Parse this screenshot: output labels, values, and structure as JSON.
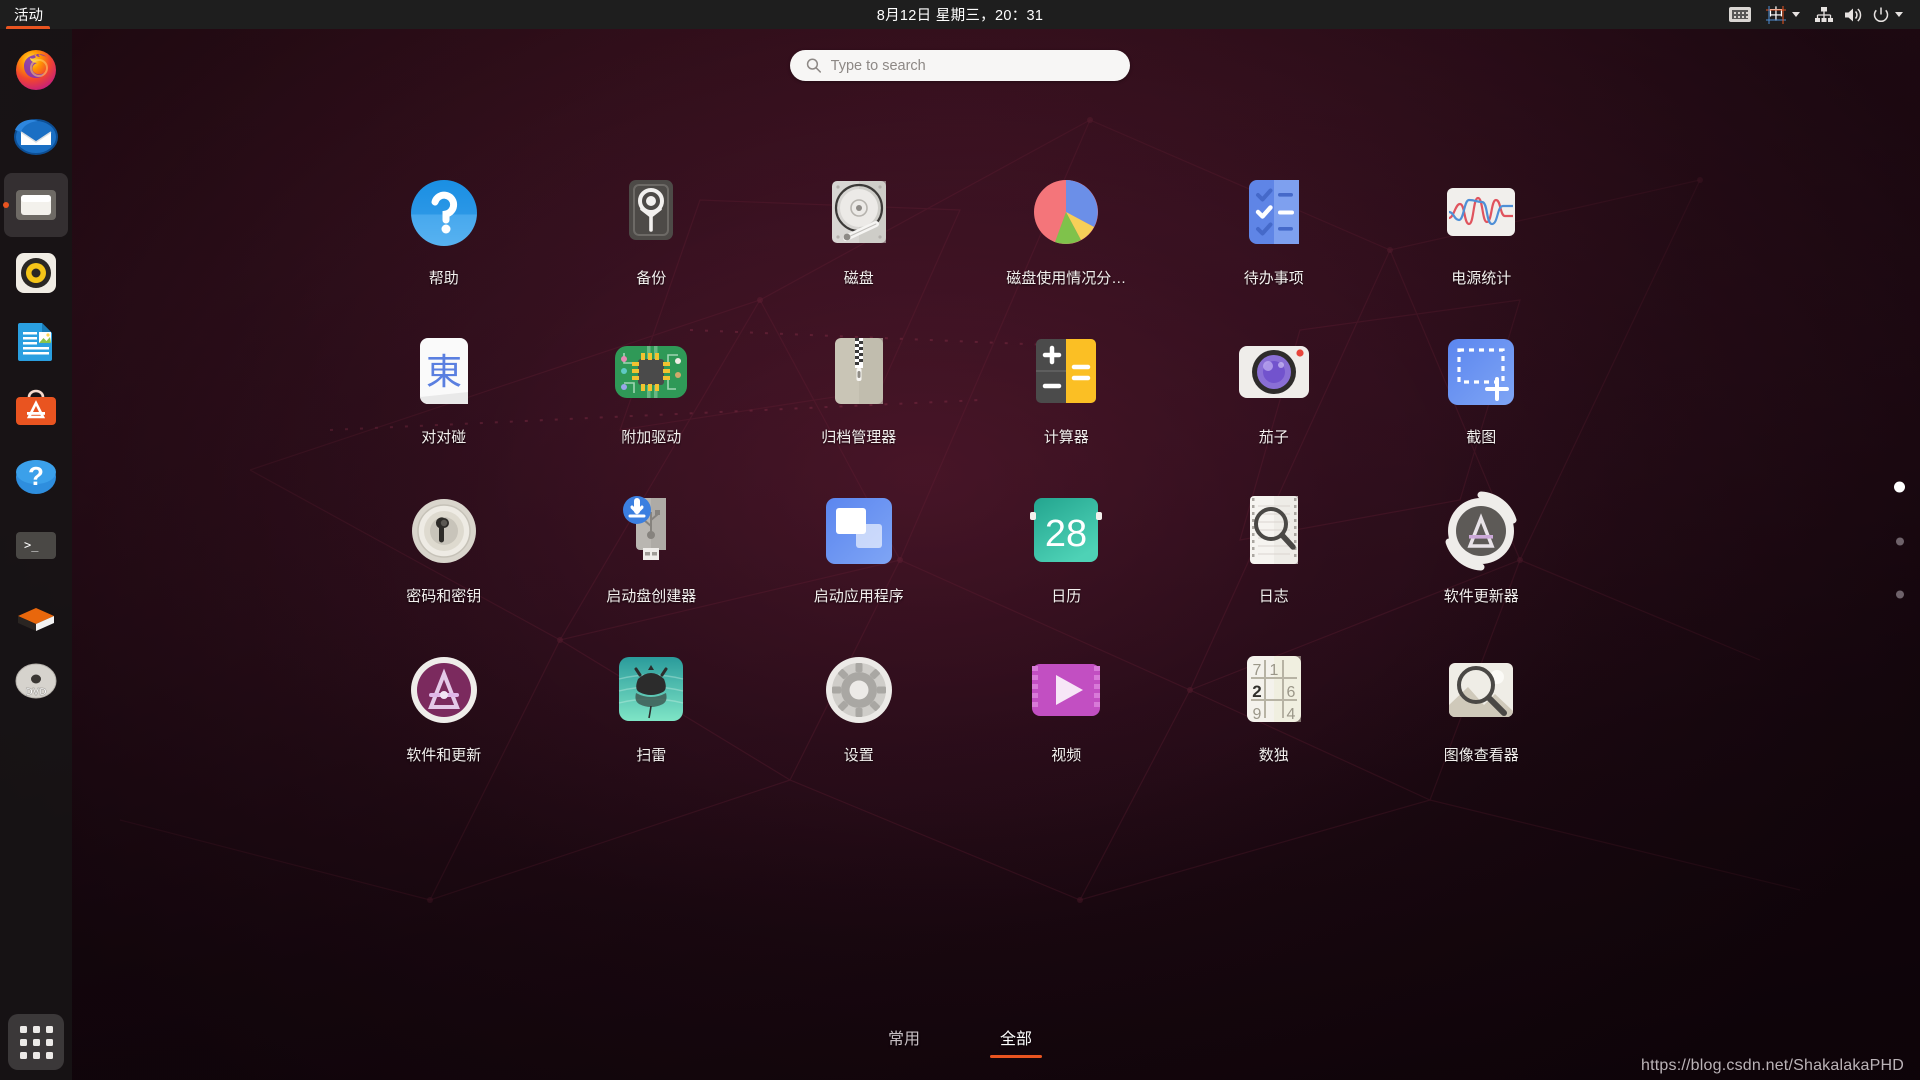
{
  "top_bar": {
    "activities_label": "活动",
    "clock": "8月12日 星期三，20：31",
    "status": {
      "keyboard_icon": "keyboard-icon",
      "ime_label": "中",
      "network_icon": "network-wired-icon",
      "volume_icon": "volume-icon",
      "power_icon": "power-icon",
      "menu_caret_icon": "chevron-down-icon"
    }
  },
  "search": {
    "placeholder": "Type to search",
    "value": "",
    "icon": "search-icon"
  },
  "dock": {
    "items": [
      {
        "name": "firefox",
        "label": "Firefox",
        "running": false
      },
      {
        "name": "thunderbird",
        "label": "Thunderbird",
        "running": false
      },
      {
        "name": "files",
        "label": "文件",
        "running": true
      },
      {
        "name": "rhythmbox",
        "label": "Rhythmbox",
        "running": false
      },
      {
        "name": "libreoffice-writer",
        "label": "LibreOffice Writer",
        "running": false
      },
      {
        "name": "ubuntu-software",
        "label": "Ubuntu 软件",
        "running": false
      },
      {
        "name": "help",
        "label": "帮助",
        "running": false
      },
      {
        "name": "terminal",
        "label": "终端",
        "running": false
      },
      {
        "name": "amazon",
        "label": "Amazon",
        "running": false
      },
      {
        "name": "dvd",
        "label": "DVD",
        "running": false
      }
    ],
    "show_apps_label": "显示应用程序"
  },
  "app_grid": {
    "apps": [
      {
        "icon": "help-icon",
        "label": "帮助"
      },
      {
        "icon": "backup-icon",
        "label": "备份"
      },
      {
        "icon": "disks-icon",
        "label": "磁盘"
      },
      {
        "icon": "disk-usage-icon",
        "label": "磁盘使用情况分…"
      },
      {
        "icon": "todo-icon",
        "label": "待办事项"
      },
      {
        "icon": "power-statistics-icon",
        "label": "电源统计"
      },
      {
        "icon": "mahjongg-icon",
        "label": "对对碰"
      },
      {
        "icon": "additional-drivers-icon",
        "label": "附加驱动"
      },
      {
        "icon": "archive-manager-icon",
        "label": "归档管理器"
      },
      {
        "icon": "calculator-icon",
        "label": "计算器"
      },
      {
        "icon": "cheese-icon",
        "label": "茄子"
      },
      {
        "icon": "screenshot-icon",
        "label": "截图"
      },
      {
        "icon": "passwords-keys-icon",
        "label": "密码和密钥"
      },
      {
        "icon": "startup-disk-creator-icon",
        "label": "启动盘创建器"
      },
      {
        "icon": "startup-applications-icon",
        "label": "启动应用程序"
      },
      {
        "icon": "calendar-icon",
        "label": "日历"
      },
      {
        "icon": "logs-icon",
        "label": "日志"
      },
      {
        "icon": "software-updater-icon",
        "label": "软件更新器"
      },
      {
        "icon": "software-and-updates-icon",
        "label": "软件和更新"
      },
      {
        "icon": "mines-icon",
        "label": "扫雷"
      },
      {
        "icon": "settings-icon",
        "label": "设置"
      },
      {
        "icon": "videos-icon",
        "label": "视频"
      },
      {
        "icon": "sudoku-icon",
        "label": "数独"
      },
      {
        "icon": "image-viewer-icon",
        "label": "图像查看器"
      }
    ],
    "calendar_day": "28",
    "mahjongg_tile": "東",
    "sudoku_cells": [
      "7",
      "1",
      "",
      "2",
      "",
      "6",
      "9",
      "",
      "4"
    ]
  },
  "page_dots": {
    "count": 3,
    "active_index": 0
  },
  "view_tabs": [
    {
      "label": "常用",
      "active": false
    },
    {
      "label": "全部",
      "active": true
    }
  ],
  "watermark": "https://blog.csdn.net/ShakalakaPHD",
  "colors": {
    "accent": "#e95420",
    "top_bar_bg": "#1e1e1e",
    "dock_bg": "#171416",
    "label_text": "#f3f0ee"
  }
}
